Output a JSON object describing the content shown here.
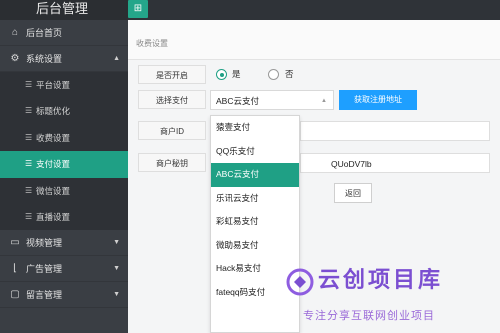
{
  "header": {
    "title": "后台管理",
    "grid_icon": "grid-icon"
  },
  "sidebar": {
    "items": [
      {
        "label": "后台首页",
        "icon": "home-icon"
      },
      {
        "label": "系统设置",
        "icon": "gear-icon",
        "expanded": true
      },
      {
        "label": "视频管理",
        "icon": "monitor-icon",
        "expanded": false
      },
      {
        "label": "广告管理",
        "icon": "chart-icon",
        "expanded": false
      },
      {
        "label": "留言管理",
        "icon": "message-icon",
        "expanded": false
      }
    ],
    "system_sub": [
      {
        "label": "平台设置"
      },
      {
        "label": "标题优化"
      },
      {
        "label": "收费设置"
      },
      {
        "label": "支付设置",
        "active": true
      },
      {
        "label": "微信设置"
      },
      {
        "label": "直播设置"
      }
    ]
  },
  "main": {
    "breadcrumb": "收费设置",
    "open_label": "是否开启",
    "radio_yes": "是",
    "radio_no": "否",
    "radio_selected": "是",
    "pay_select_label": "选择支付",
    "pay_selected": "ABC云支付",
    "get_url_button": "获取注册地址",
    "merchant_id_label": "商户ID",
    "merchant_key_label": "商户秘钥",
    "merchant_key_value": "QUoDV7lb",
    "back_button": "返回",
    "dropdown_options": [
      "猿壹支付",
      "QQ乐支付",
      "ABC云支付",
      "乐讯云支付",
      "彩虹易支付",
      "微助易支付",
      "Hack易支付",
      "fateqq码支付"
    ]
  },
  "watermark": {
    "title": "云创项目库",
    "subtitle": "专注分享互联网创业项目"
  },
  "colors": {
    "accent": "#1fa085",
    "button_blue": "#1e9fff",
    "sidebar_bg": "#3a3e44",
    "watermark": "#7b4fd1"
  }
}
